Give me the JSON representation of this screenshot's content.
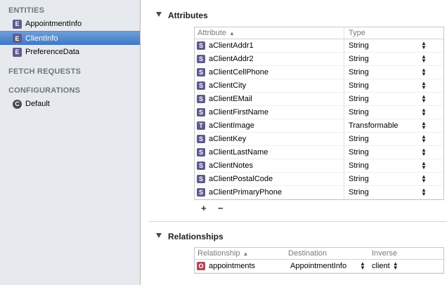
{
  "sidebar": {
    "entities_header": "ENTITIES",
    "entities": [
      {
        "badge": "E",
        "label": "AppointmentInfo",
        "selected": false
      },
      {
        "badge": "E",
        "label": "ClientInfo",
        "selected": true
      },
      {
        "badge": "E",
        "label": "PreferenceData",
        "selected": false
      }
    ],
    "fetch_header": "FETCH REQUESTS",
    "config_header": "CONFIGURATIONS",
    "configurations": [
      {
        "badge": "C",
        "label": "Default"
      }
    ]
  },
  "attributes": {
    "title": "Attributes",
    "col_attribute": "Attribute",
    "col_type": "Type",
    "sort_indicator": "▲",
    "rows": [
      {
        "badge": "S",
        "name": "aClientAddr1",
        "type": "String"
      },
      {
        "badge": "S",
        "name": "aClientAddr2",
        "type": "String"
      },
      {
        "badge": "S",
        "name": "aClientCellPhone",
        "type": "String"
      },
      {
        "badge": "S",
        "name": "aClientCity",
        "type": "String"
      },
      {
        "badge": "S",
        "name": "aClientEMail",
        "type": "String"
      },
      {
        "badge": "S",
        "name": "aClientFirstName",
        "type": "String"
      },
      {
        "badge": "T",
        "name": "aClientImage",
        "type": "Transformable"
      },
      {
        "badge": "S",
        "name": "aClientKey",
        "type": "String"
      },
      {
        "badge": "S",
        "name": "aClientLastName",
        "type": "String"
      },
      {
        "badge": "S",
        "name": "aClientNotes",
        "type": "String"
      },
      {
        "badge": "S",
        "name": "aClientPostalCode",
        "type": "String"
      },
      {
        "badge": "S",
        "name": "aClientPrimaryPhone",
        "type": "String"
      }
    ],
    "add_label": "+",
    "remove_label": "−"
  },
  "relationships": {
    "title": "Relationships",
    "col_relationship": "Relationship",
    "col_destination": "Destination",
    "col_inverse": "Inverse",
    "sort_indicator": "▲",
    "rows": [
      {
        "badge": "O",
        "name": "appointments",
        "destination": "AppointmentInfo",
        "inverse": "client"
      }
    ]
  },
  "colors": {
    "entity_badge": "#5d5c8e",
    "relationship_badge": "#b0475a",
    "selection": "#3f78c6",
    "sidebar_bg": "#e6eaee"
  },
  "icons": {
    "disclosure": "disclosure-triangle-down-icon",
    "stepper": "up-down-stepper-icon"
  }
}
